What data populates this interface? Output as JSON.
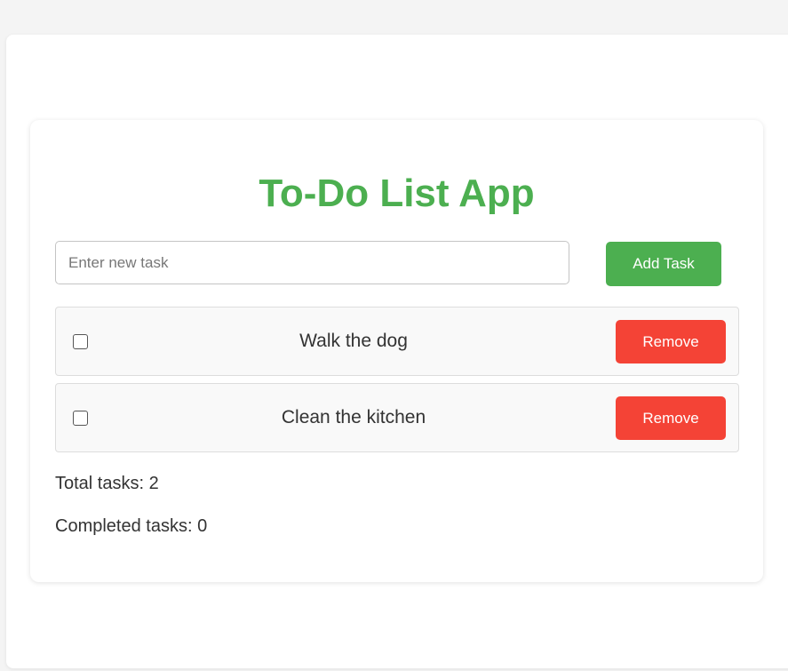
{
  "app": {
    "title": "To-Do List App"
  },
  "input": {
    "placeholder": "Enter new task",
    "value": ""
  },
  "buttons": {
    "add_label": "Add Task",
    "remove_label": "Remove"
  },
  "tasks": [
    {
      "text": "Walk the dog",
      "completed": false
    },
    {
      "text": "Clean the kitchen",
      "completed": false
    }
  ],
  "stats": {
    "total": "Total tasks: 2",
    "completed": "Completed tasks: 0"
  },
  "colors": {
    "accent": "#4caf50",
    "danger": "#f44336"
  }
}
